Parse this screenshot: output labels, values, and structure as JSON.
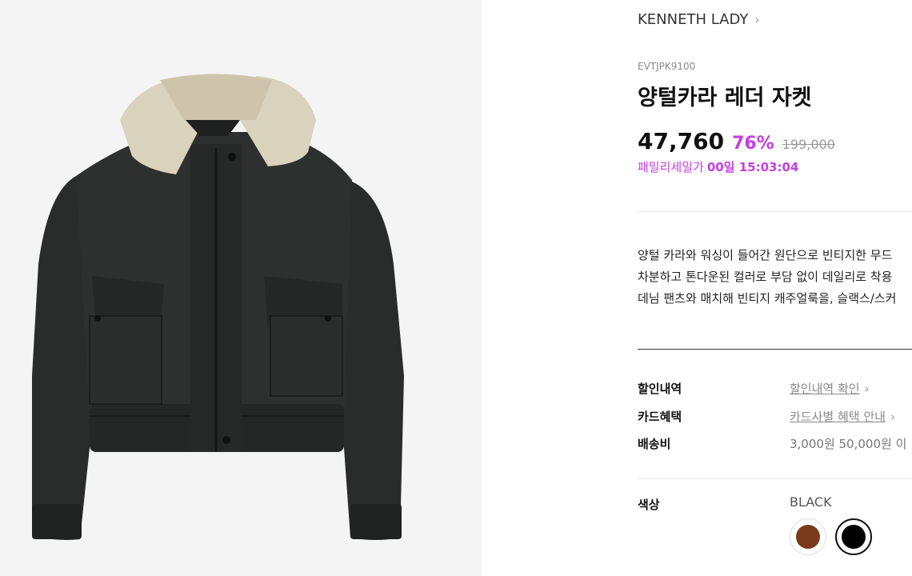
{
  "product": {
    "brand": "KENNETH LADY",
    "code": "EVTJPK9100",
    "title": "양털카라 레더 자켓",
    "price": "47,760",
    "discount": "76%",
    "original_price": "199,000",
    "timer_label": "패밀리세일가",
    "timer_value": "00일 15:03:04",
    "description": [
      "양털 카라와 워싱이 들어간 원단으로 빈티지한 무드",
      "차분하고 톤다운된 컬러로 부담 없이 데일리로 착용",
      "데님 팬츠와 매치해 빈티지 캐주얼룩을, 슬랙스/스커"
    ]
  },
  "info_rows": {
    "discount": {
      "label": "할인내역",
      "value": "할인내역 확인"
    },
    "card": {
      "label": "카드혜택",
      "value": "카드사별 혜택 안내"
    },
    "shipping": {
      "label": "배송비",
      "value": "3,000원 50,000원 이"
    }
  },
  "color_option": {
    "label": "색상",
    "selected": "BLACK",
    "swatches": [
      {
        "name": "brown",
        "hex": "#7a3a1a"
      },
      {
        "name": "black",
        "hex": "#000000"
      }
    ]
  },
  "colors": {
    "accent": "#c43fe1",
    "image_bg": "#f4f4f4"
  }
}
